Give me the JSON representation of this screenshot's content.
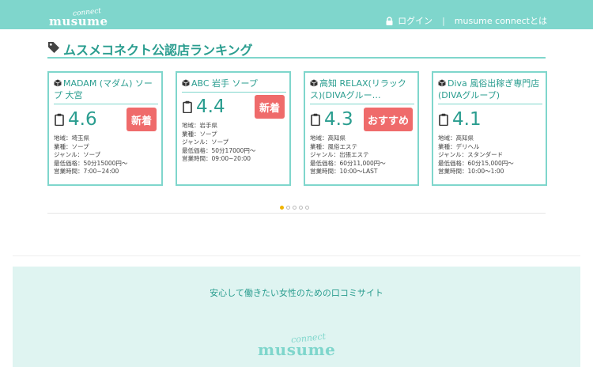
{
  "header": {
    "logo_small": "connect",
    "logo_main": "musume",
    "login_label": "ログイン",
    "separator": "|",
    "about_label": "musume connectとは"
  },
  "section": {
    "title": "ムスメコネクト公認店ランキング"
  },
  "cards": [
    {
      "name": "MADAM (マダム) ソープ 大宮",
      "rating": "4.6",
      "badge": "新着",
      "area": "地域：埼玉県",
      "type": "業種：ソープ",
      "genre": "ジャンル：ソープ",
      "price": "最低価格：50分15000円〜",
      "hours": "営業時間：7:00~24:00"
    },
    {
      "name": "ABC 岩手 ソープ",
      "rating": "4.4",
      "badge": "新着",
      "area": "地域：岩手県",
      "type": "業種：ソープ",
      "genre": "ジャンル：ソープ",
      "price": "最低価格：50分17000円〜",
      "hours": "営業時間：09:00~20:00"
    },
    {
      "name": "高知 RELAX(リラックス)(DIVAグルー…",
      "rating": "4.3",
      "badge": "おすすめ",
      "area": "地域：高知県",
      "type": "業種：風俗エステ",
      "genre": "ジャンル：出張エステ",
      "price": "最低価格：60分11,000円〜",
      "hours": "営業時間：10:00〜LAST"
    },
    {
      "name": "Diva 風俗出稼ぎ専門店(DIVAグループ)",
      "rating": "4.1",
      "badge": "",
      "area": "地域：高知県",
      "type": "業種：デリヘル",
      "genre": "ジャンル：スタンダード",
      "price": "最低価格：60分15,000円〜",
      "hours": "営業時間：10:00〜1:00"
    }
  ],
  "carousel": {
    "total": 5,
    "active": 1
  },
  "footer": {
    "tagline": "安心して働きたい女性のための口コミサイト",
    "logo_small": "connect",
    "logo_main": "musume"
  },
  "colors": {
    "accent": "#7fd6cc",
    "accent_text": "#2a9d8f",
    "badge": "#ef6b6b",
    "dot_active": "#f0b400",
    "footer_bg": "#dff4f1"
  }
}
